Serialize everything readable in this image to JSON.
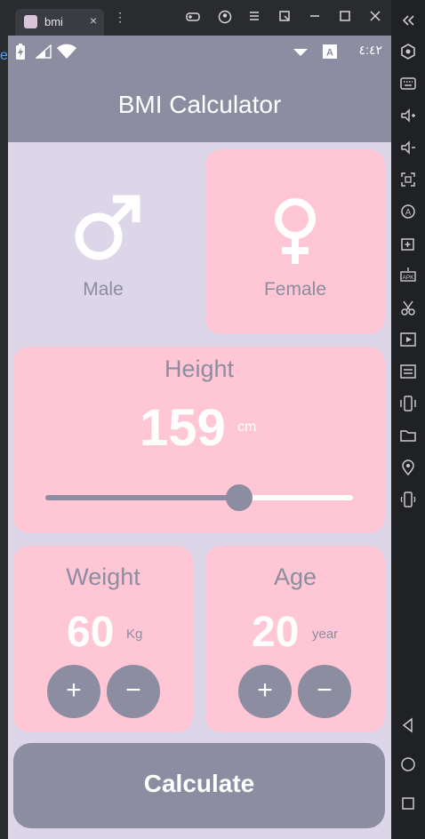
{
  "window": {
    "tab_title": "bmi",
    "tab_close": "×",
    "menu_glyph": "⋮",
    "edge_letter": "e"
  },
  "status": {
    "time": "٤:٤٢"
  },
  "app": {
    "title": "BMI Calculator"
  },
  "gender": {
    "male_label": "Male",
    "female_label": "Female",
    "selected": "female"
  },
  "height": {
    "label": "Height",
    "value": "159",
    "unit": "cm",
    "slider_fraction": 0.63
  },
  "weight": {
    "label": "Weight",
    "value": "60",
    "unit": "Kg",
    "plus": "+",
    "minus": "−"
  },
  "age": {
    "label": "Age",
    "value": "20",
    "unit": "year",
    "plus": "+",
    "minus": "−"
  },
  "actions": {
    "calculate": "Calculate"
  },
  "colors": {
    "accent": "#8c8da0",
    "card": "#ffc7d5",
    "background": "#dcd6e8",
    "slider_active": "#8c8da0",
    "slider_inactive": "#ffffff"
  }
}
